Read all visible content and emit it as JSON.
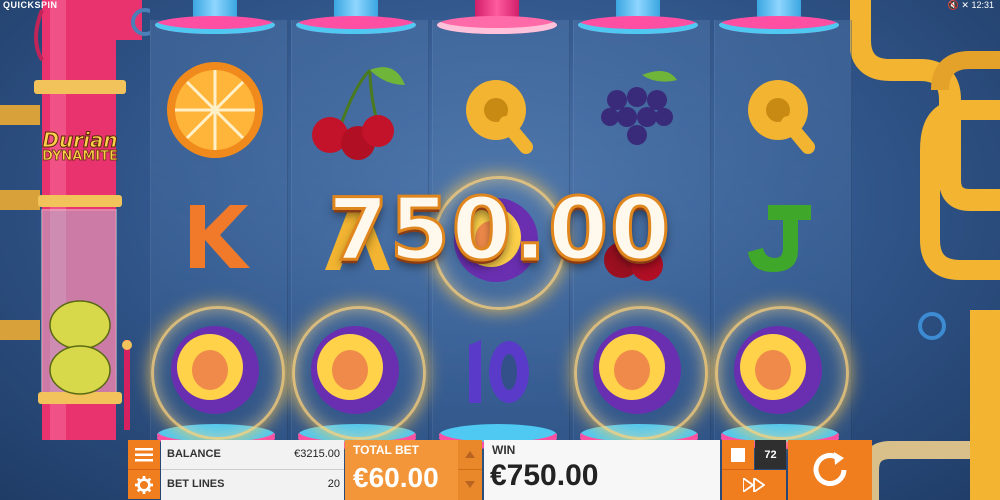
{
  "brand": "QUICKSPIN",
  "status": {
    "clock": "12:31",
    "sound_icon": "speaker-muted-icon",
    "close_icon": "close-icon"
  },
  "logo": {
    "line1": "Durian",
    "line2": "DYNAMITE"
  },
  "win_overlay": "750.00",
  "reels": [
    [
      "orange",
      "k-letter",
      "durian-plum"
    ],
    [
      "cherry",
      "a-letter",
      "durian-plum"
    ],
    [
      "q-letter",
      "durian-plum",
      "ten"
    ],
    [
      "grapes",
      "cherry",
      "durian-plum"
    ],
    [
      "q-letter",
      "j-letter",
      "durian-plum"
    ]
  ],
  "controls": {
    "menu_icon": "hamburger-icon",
    "settings_icon": "gear-icon",
    "balance_label": "BALANCE",
    "balance_value": "€3215.00",
    "bet_lines_label": "BET LINES",
    "bet_lines_value": "20",
    "total_bet_label": "TOTAL BET",
    "total_bet_value": "€60.00",
    "win_label": "WIN",
    "win_value": "€750.00",
    "autoplay_count": "72",
    "spin_icon": "refresh-icon",
    "turbo_icon": "fast-forward-icon",
    "stop_icon": "stop-icon"
  },
  "colors": {
    "accent": "#f07d1e",
    "pipe_pink": "#e8336e",
    "pipe_yellow": "#f2b431",
    "nozzle_blue": "#4fc8f2"
  }
}
